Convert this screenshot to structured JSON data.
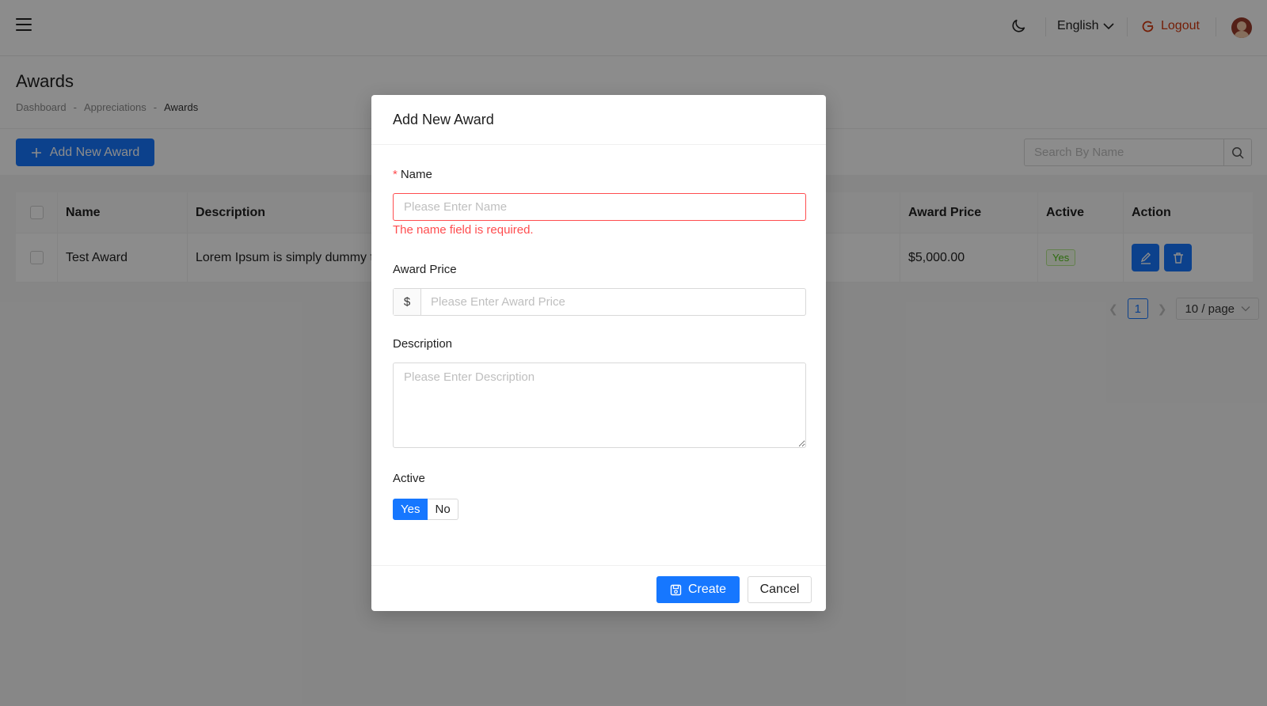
{
  "header": {
    "language": "English",
    "logout_label": "Logout"
  },
  "page": {
    "title": "Awards",
    "breadcrumb": [
      "Dashboard",
      "-",
      "Appreciations",
      "-",
      "Awards"
    ]
  },
  "toolbar": {
    "add_label": "Add New Award",
    "search_placeholder": "Search By Name"
  },
  "table": {
    "columns": [
      "Name",
      "Description",
      "Award Price",
      "Active",
      "Action"
    ],
    "rows": [
      {
        "name": "Test Award",
        "description": "Lorem Ipsum is simply dummy te",
        "price": "$5,000.00",
        "active": "Yes"
      }
    ]
  },
  "pagination": {
    "current_page": "1",
    "page_size": "10 / page"
  },
  "modal": {
    "title": "Add New Award",
    "name_label": "Name",
    "name_required_mark": "*",
    "name_placeholder": "Please Enter Name",
    "name_error": "The name field is required.",
    "price_label": "Award Price",
    "price_prefix": "$",
    "price_placeholder": "Please Enter Award Price",
    "description_label": "Description",
    "description_placeholder": "Please Enter Description",
    "active_label": "Active",
    "active_options": [
      "Yes",
      "No"
    ],
    "active_selected": "Yes",
    "create_label": "Create",
    "cancel_label": "Cancel"
  },
  "colors": {
    "primary": "#1677ff",
    "error": "#ff4d4f",
    "logout": "#d4380d",
    "success": "#52c41a"
  },
  "icons": [
    "menu-icon",
    "moon-icon",
    "chevron-down-icon",
    "logout-icon",
    "avatar",
    "plus-icon",
    "search-icon",
    "edit-icon",
    "delete-icon",
    "save-icon",
    "chevron-left-icon",
    "chevron-right-icon"
  ]
}
